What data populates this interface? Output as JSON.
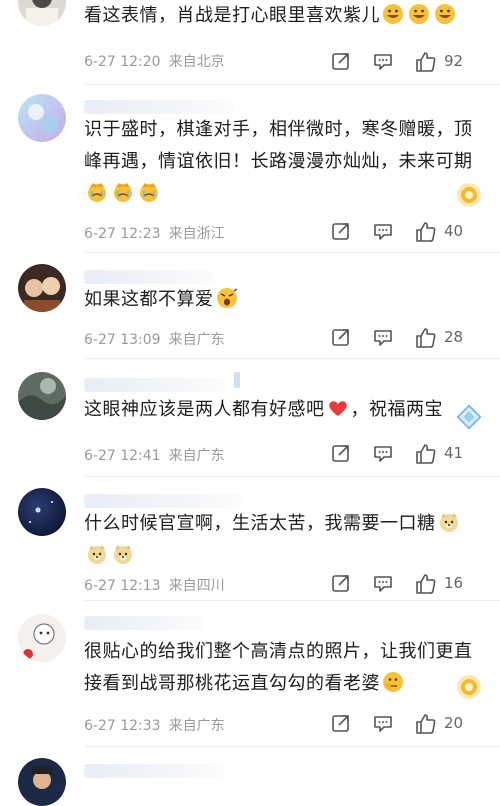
{
  "comments": [
    {
      "text": "看这表情，肖战是打心眼里喜欢紫儿",
      "emojis": [
        "grin-emoji",
        "grin-emoji",
        "grin-emoji"
      ],
      "time": "6-27 12:20",
      "location": "来自北京",
      "likes": "92"
    },
    {
      "text": "识于盛时，棋逢对手，相伴微时，寒冬赠暖，顶峰再遇，情谊依旧！长路漫漫亦灿灿，未来可期",
      "emojis": [
        "crown-cry-emoji",
        "crown-cry-emoji",
        "crown-cry-emoji"
      ],
      "time": "6-27 12:23",
      "location": "来自浙江",
      "likes": "40"
    },
    {
      "text": "如果这都不算爱",
      "emojis": [
        "shocked-emoji"
      ],
      "time": "6-27 13:09",
      "location": "来自广东",
      "likes": "28"
    },
    {
      "text": "这眼神应该是两人都有好感吧",
      "emojis": [
        "red-heart-emoji"
      ],
      "text_after": "，祝福两宝",
      "time": "6-27 12:41",
      "location": "来自广东",
      "likes": "41"
    },
    {
      "text": "什么时候官宣啊，生活太苦，我需要一口糖",
      "emojis": [
        "doge-emoji",
        "doge-emoji",
        "doge-emoji"
      ],
      "time": "6-27 12:13",
      "location": "来自四川",
      "likes": "16"
    },
    {
      "text": "很贴心的给我们整个高清点的照片，让我们更直接看到战哥那桃花运直勾勾的看老婆",
      "emojis": [
        "thinking-emoji"
      ],
      "time": "6-27 12:33",
      "location": "来自广东",
      "likes": "20"
    }
  ],
  "colors": {
    "meta_text": "#9a9a9a",
    "like_count": "#666666",
    "emoji_yellow": "#f7c23b",
    "heart_red": "#e83a3a",
    "badge_blue": "#6fb0f0"
  }
}
